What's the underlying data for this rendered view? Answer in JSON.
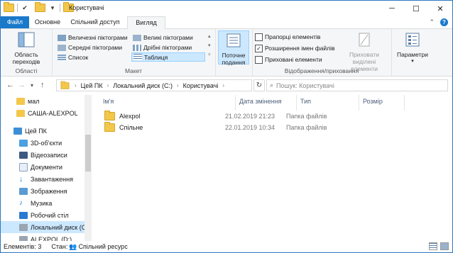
{
  "window": {
    "title": "Користувачі"
  },
  "tabs": {
    "file": "Файл",
    "home": "Основне",
    "share": "Спільний доступ",
    "view": "Вигляд"
  },
  "ribbon": {
    "panes": {
      "nav_pane": "Область переходів",
      "label": "Області"
    },
    "layout": {
      "label": "Макет",
      "xl_icons": "Величезні піктограми",
      "large_icons": "Великі піктограми",
      "medium_icons": "Середні піктограми",
      "small_icons": "Дрібні піктограми",
      "list": "Список",
      "details": "Таблиця"
    },
    "current_view": {
      "sort": "Поточне подання"
    },
    "show_hide": {
      "label": "Відображення/приховання",
      "item_checkboxes": "Прапорці елементів",
      "file_extensions": "Розширення імен файлів",
      "hidden_items": "Приховані елементи",
      "hide_selected": "Приховати виділені елементи"
    },
    "options": "Параметри"
  },
  "address": {
    "crumbs": [
      "Цей ПК",
      "Локальний диск (C:)",
      "Користувачі"
    ],
    "search_placeholder": "Пошук: Користувачі"
  },
  "nav": {
    "items": [
      {
        "label": "мал",
        "icon": "folder-icon"
      },
      {
        "label": "САША-ALEXPOL",
        "icon": "folder-icon"
      },
      {
        "label": "Цей ПК",
        "icon": "computer-icon"
      },
      {
        "label": "3D-об'єкти",
        "icon": "3d-objects-icon"
      },
      {
        "label": "Відеозаписи",
        "icon": "videos-icon"
      },
      {
        "label": "Документи",
        "icon": "documents-icon"
      },
      {
        "label": "Завантаження",
        "icon": "downloads-icon"
      },
      {
        "label": "Зображення",
        "icon": "pictures-icon"
      },
      {
        "label": "Музика",
        "icon": "music-icon"
      },
      {
        "label": "Робочий стіл",
        "icon": "desktop-icon"
      },
      {
        "label": "Локальний диск (C:",
        "icon": "drive-icon"
      },
      {
        "label": "ALEXPOL (D:)",
        "icon": "drive-icon"
      }
    ]
  },
  "columns": {
    "name": "Ім'я",
    "date": "Дата змінення",
    "type": "Тип",
    "size": "Розмір"
  },
  "files": [
    {
      "name": "Alexpol",
      "date": "21.02.2019 21:23",
      "type": "Папка файлів"
    },
    {
      "name": "Спільне",
      "date": "22.01.2019 10:34",
      "type": "Папка файлів"
    }
  ],
  "status": {
    "count": "Елементів: 3",
    "state": "Стан:",
    "shared": "Спільний ресурс"
  }
}
